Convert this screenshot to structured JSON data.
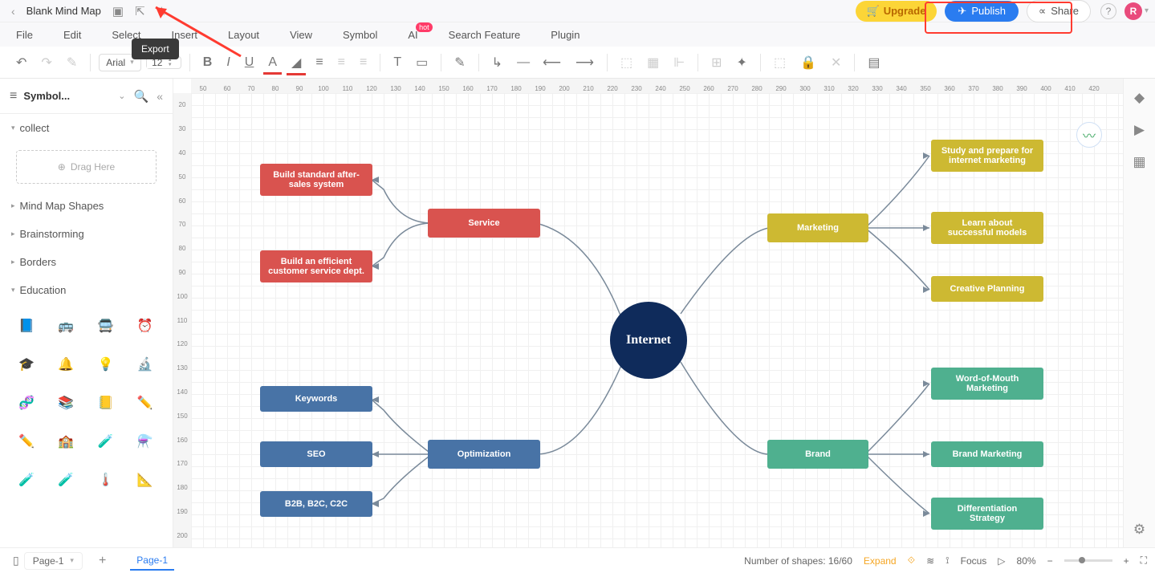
{
  "header": {
    "doc_title": "Blank Mind Map",
    "upgrade": "Upgrade",
    "publish": "Publish",
    "share": "Share",
    "avatar_letter": "R"
  },
  "tooltip": {
    "export": "Export"
  },
  "menubar": [
    "File",
    "Edit",
    "Select",
    "Insert",
    "Layout",
    "View",
    "Symbol",
    "AI",
    "Search Feature",
    "Plugin"
  ],
  "toolbar": {
    "font": "Arial",
    "size": "12"
  },
  "sidebar": {
    "title": "Symbol...",
    "collect": "collect",
    "drag": "Drag Here",
    "categories": [
      "Mind Map Shapes",
      "Brainstorming",
      "Borders"
    ],
    "education": "Education"
  },
  "ruler_h": [
    50,
    60,
    70,
    80,
    90,
    100,
    110,
    120,
    130,
    140,
    150,
    160,
    170,
    180,
    190,
    200,
    210,
    220,
    230,
    240,
    250,
    260,
    270,
    280,
    290,
    300,
    310,
    320,
    330,
    340,
    350,
    360,
    370,
    380,
    390,
    400,
    410,
    420
  ],
  "ruler_v": [
    20,
    30,
    40,
    50,
    60,
    70,
    80,
    90,
    100,
    110,
    120,
    130,
    140,
    150,
    160,
    170,
    180,
    190,
    200
  ],
  "mindmap": {
    "center": "Internet",
    "service": "Service",
    "service_leaf1": "Build standard after-sales system",
    "service_leaf2": "Build an efficient customer service dept.",
    "marketing": "Marketing",
    "marketing_leaf1": "Study and prepare for internet marketing",
    "marketing_leaf2": "Learn about successful models",
    "marketing_leaf3": "Creative Planning",
    "optimization": "Optimization",
    "opt_leaf1": "Keywords",
    "opt_leaf2": "SEO",
    "opt_leaf3": "B2B, B2C, C2C",
    "brand": "Brand",
    "brand_leaf1": "Word-of-Mouth Marketing",
    "brand_leaf2": "Brand Marketing",
    "brand_leaf3": "Differentiation Strategy"
  },
  "status": {
    "page_label": "Page-1",
    "page_tab": "Page-1",
    "shapes": "Number of shapes: 16/60",
    "expand": "Expand",
    "focus": "Focus",
    "zoom": "80%"
  }
}
